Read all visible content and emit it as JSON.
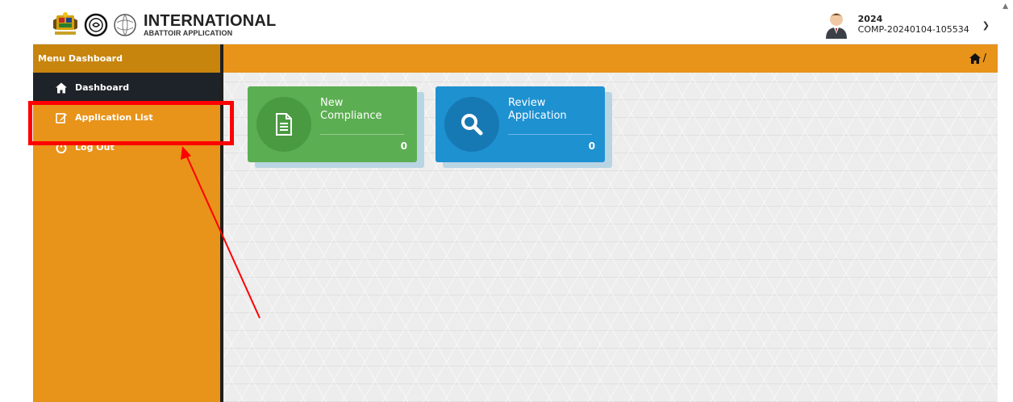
{
  "header": {
    "brand_title": "INTERNATIONAL",
    "brand_subtitle": "ABATTOIR APPLICATION",
    "user_year": "2024",
    "user_id": "COMP-20240104-105534"
  },
  "menu": {
    "heading": "Menu Dashboard",
    "items": [
      {
        "label": "Dashboard",
        "icon": "home-icon"
      },
      {
        "label": "Application List",
        "icon": "edit-icon"
      },
      {
        "label": "Log Out",
        "icon": "power-icon"
      }
    ]
  },
  "breadcrumb": {
    "separator": "/"
  },
  "cards": [
    {
      "title_line1": "New",
      "title_line2": "Compliance",
      "count": "0",
      "icon": "document-icon",
      "color": "#5cae52"
    },
    {
      "title_line1": "Review",
      "title_line2": "Application",
      "count": "0",
      "icon": "search-icon",
      "color": "#1e91d1"
    }
  ],
  "colors": {
    "sidebar": "#e8931a",
    "active_item": "#1e2329",
    "highlight": "#ff0000"
  }
}
